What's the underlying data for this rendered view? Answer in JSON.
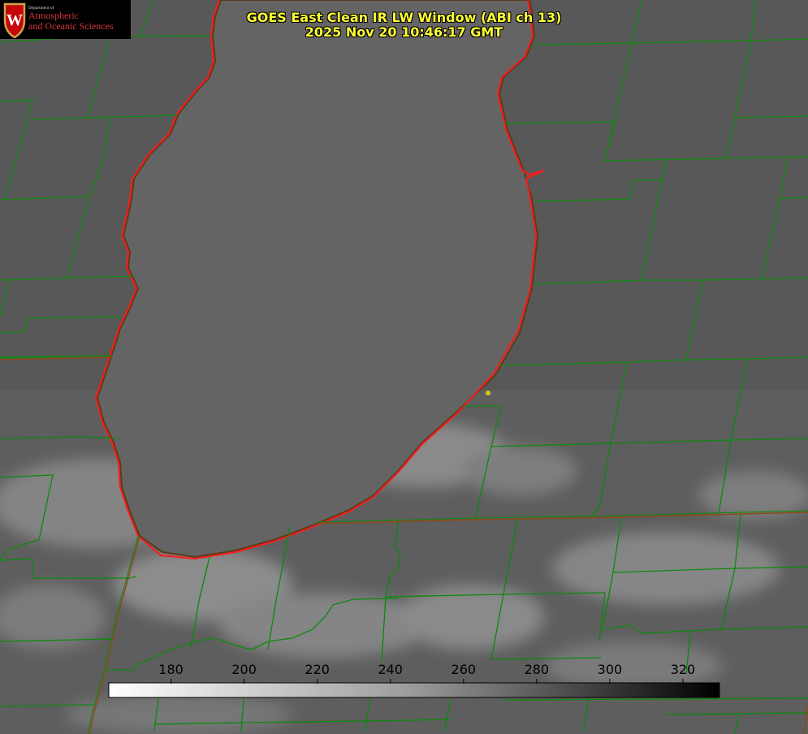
{
  "header": {
    "title_line1": "GOES East Clean IR LW Window (ABI ch 13)",
    "title_line2": "2025 Nov 20 10:46:17 GMT"
  },
  "logo": {
    "department": "Department of",
    "line1": "Atmospheric",
    "line2": "and Oceanic Sciences",
    "letter": "W"
  },
  "colorbar": {
    "tick_labels": [
      "180",
      "200",
      "220",
      "240",
      "260",
      "280",
      "300",
      "320"
    ],
    "ticks": [
      180,
      200,
      220,
      240,
      260,
      280,
      300,
      320
    ],
    "range": [
      163,
      330
    ],
    "gradient_start": "#ffffff",
    "gradient_end": "#000000"
  },
  "map": {
    "coastline_color": "#ff1a1a",
    "boundary_color": "#0b8a0b",
    "state_line_color": "#8a4b1a",
    "marker_color": "#d9c21a"
  }
}
